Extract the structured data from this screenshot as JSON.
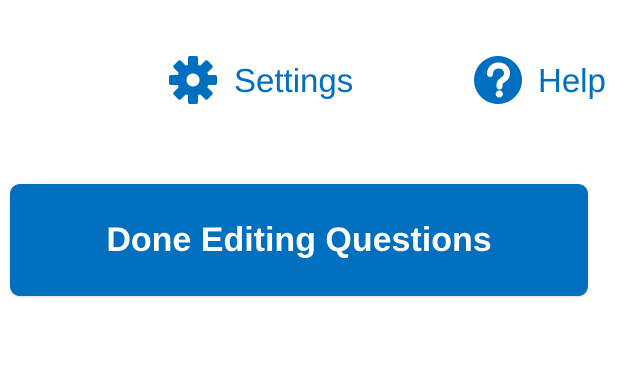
{
  "toolbar": {
    "settings": {
      "label": "Settings",
      "icon": "gear-icon"
    },
    "help": {
      "label": "Help",
      "icon": "help-circle-icon"
    }
  },
  "actions": {
    "done_editing_label": "Done Editing Questions"
  },
  "colors": {
    "accent": "#006fbf",
    "button_text": "#ffffff",
    "background": "#ffffff"
  }
}
